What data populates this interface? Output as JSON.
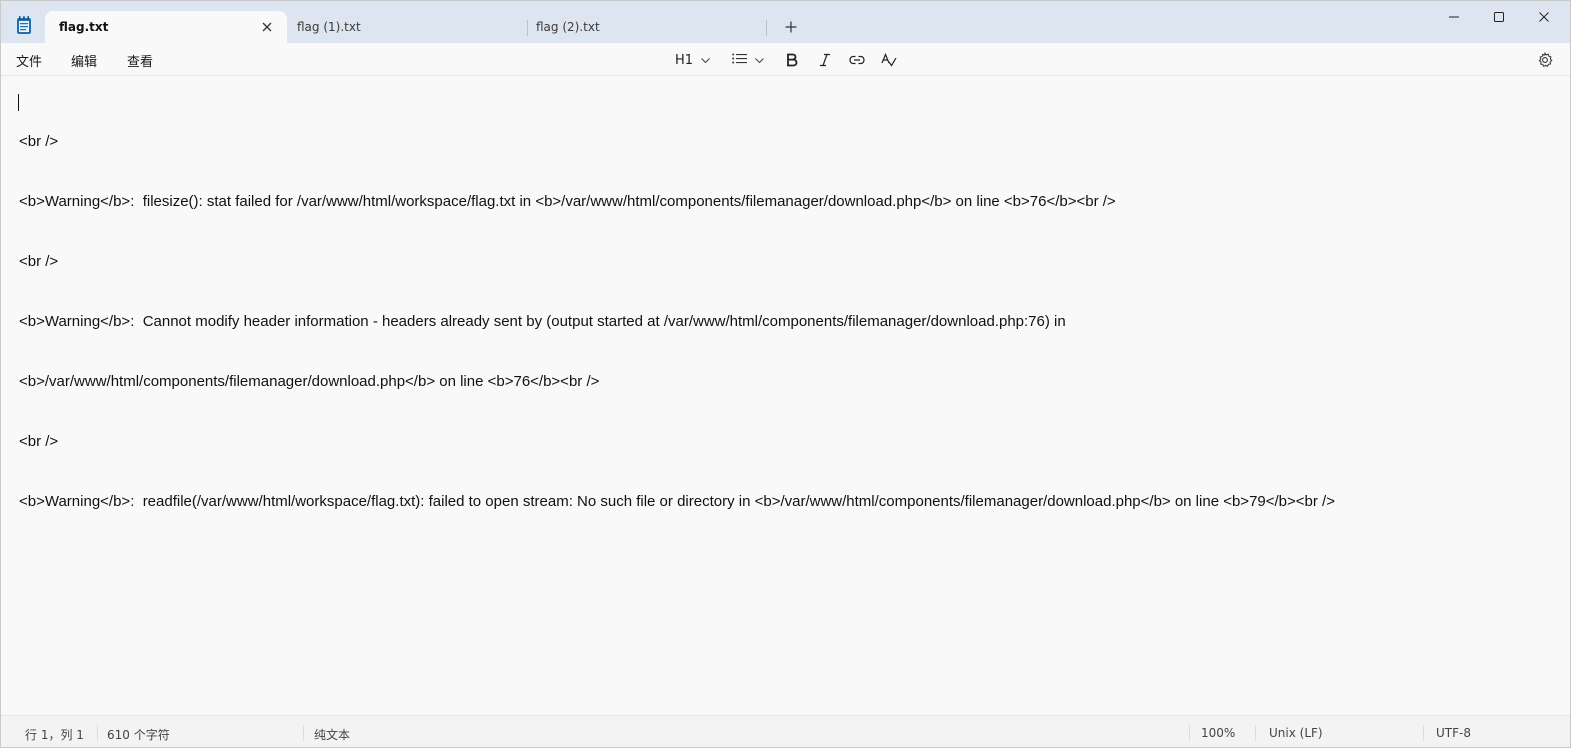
{
  "tabs": [
    {
      "label": "flag.txt",
      "active": true
    },
    {
      "label": "flag (1).txt",
      "active": false
    },
    {
      "label": "flag (2).txt",
      "active": false
    }
  ],
  "menu": {
    "file": "文件",
    "edit": "编辑",
    "view": "查看"
  },
  "toolbar": {
    "heading": "H1"
  },
  "editor": {
    "lines": [
      "<br />",
      "<b>Warning</b>:  filesize(): stat failed for /var/www/html/workspace/flag.txt in <b>/var/www/html/components/filemanager/download.php</b> on line <b>76</b><br />",
      "<br />",
      "<b>Warning</b>:  Cannot modify header information - headers already sent by (output started at /var/www/html/components/filemanager/download.php:76) in",
      "<b>/var/www/html/components/filemanager/download.php</b> on line <b>76</b><br />",
      "<br />",
      "<b>Warning</b>:  readfile(/var/www/html/workspace/flag.txt): failed to open stream: No such file or directory in <b>/var/www/html/components/filemanager/download.php</b> on line <b>79</b><br />"
    ]
  },
  "status": {
    "position": "行 1，列 1",
    "char_count": "610 个字符",
    "format": "纯文本",
    "zoom": "100%",
    "line_ending": "Unix (LF)",
    "encoding": "UTF-8"
  },
  "colors": {
    "titlebar": "#dde6f0",
    "editor_bg": "#f9f9f9",
    "accent": "#1f6fb2"
  },
  "icons": {
    "app": "notepad-icon",
    "close_tab": "close-icon",
    "new_tab": "plus-icon",
    "minimize": "minimize-icon",
    "maximize": "maximize-icon",
    "close_window": "close-window-icon",
    "list": "list-icon",
    "bold": "bold-icon",
    "italic": "italic-icon",
    "link": "link-icon",
    "spellcheck": "spellcheck-icon",
    "settings": "gear-icon"
  }
}
